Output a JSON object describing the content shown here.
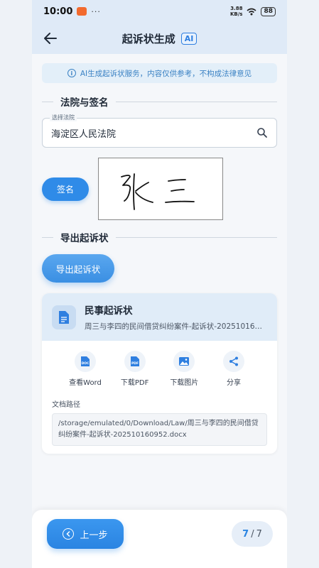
{
  "status": {
    "time": "10:00",
    "dots": "···",
    "speed_top": "3.88",
    "speed_bottom": "KB/s",
    "battery": "88"
  },
  "header": {
    "title": "起诉状生成",
    "badge": "AI"
  },
  "notice": {
    "icon": "info-icon",
    "text": "AI生成起诉状服务，内容仅供参考，不构成法律意见"
  },
  "court_section": {
    "title": "法院与签名",
    "field_label": "选择法院",
    "field_value": "海淀区人民法院",
    "sign_button": "签名",
    "signature_text": "张三"
  },
  "export_section": {
    "title": "导出起诉状",
    "export_button": "导出起诉状"
  },
  "document": {
    "title": "民事起诉状",
    "filename": "周三与李四的民间借贷纠纷案件-起诉状-202510160...",
    "actions": [
      {
        "label": "查看Word",
        "icon": "doc-icon"
      },
      {
        "label": "下载PDF",
        "icon": "pdf-icon"
      },
      {
        "label": "下载图片",
        "icon": "image-icon"
      },
      {
        "label": "分享",
        "icon": "share-icon"
      }
    ],
    "path_label": "文档路径",
    "path_value": "/storage/emulated/0/Download/Law/周三与李四的民间借贷纠纷案件-起诉状-202510160952.docx"
  },
  "footer": {
    "prev_label": "上一步",
    "step_current": "7",
    "step_sep": "/",
    "step_total": "7"
  },
  "colors": {
    "accent": "#2f8be8",
    "header_bg": "#dfeaf7",
    "notice_text": "#3b82c4"
  }
}
